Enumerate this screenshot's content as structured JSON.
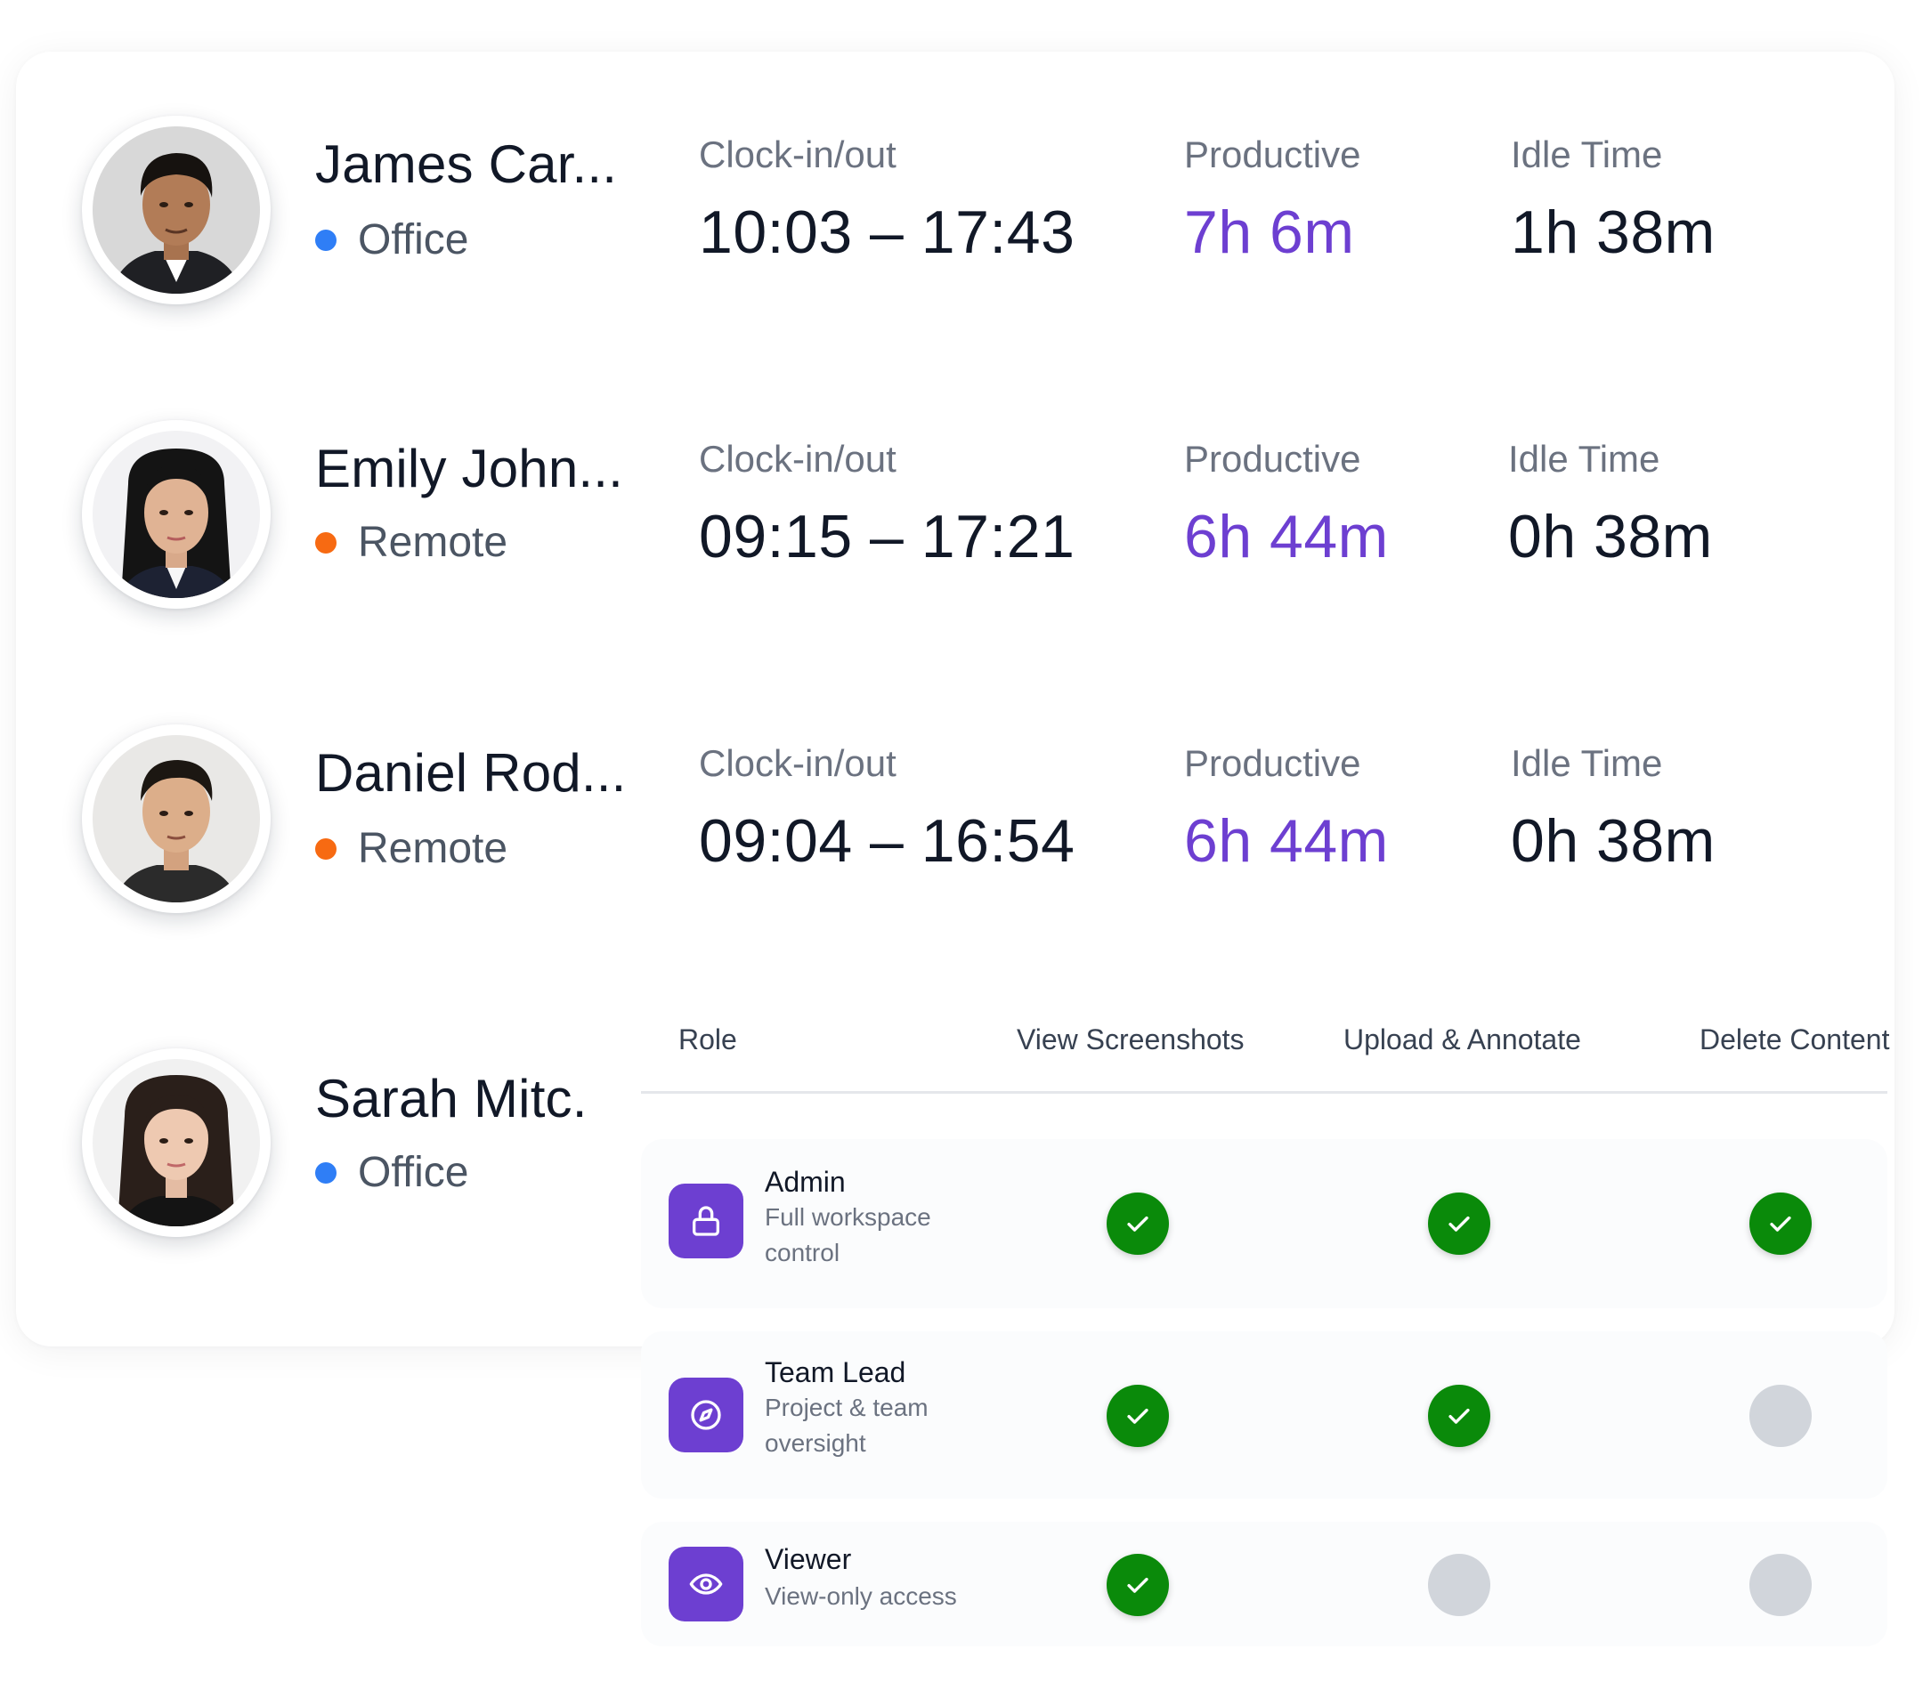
{
  "colors": {
    "office_dot": "#2f7ef6",
    "remote_dot": "#f76a12",
    "productive_text": "#6d3fd1",
    "role_icon_bg": "#6d3fd1",
    "check_on": "#0a8a0a",
    "check_off": "#d1d5db"
  },
  "employees": [
    {
      "name": "James Car...",
      "location": "Office",
      "location_type": "office",
      "clock_label": "Clock-in/out",
      "clock_value": "10:03 – 17:43",
      "productive_label": "Productive",
      "productive_value": "7h 6m",
      "idle_label": "Idle Time",
      "idle_value": "1h 38m",
      "avatar": "person-photo-male-dark-hair"
    },
    {
      "name": "Emily John...",
      "location": "Remote",
      "location_type": "remote",
      "clock_label": "Clock-in/out",
      "clock_value": "09:15 – 17:21",
      "productive_label": "Productive",
      "productive_value": "6h 44m",
      "idle_label": "Idle Time",
      "idle_value": "0h 38m",
      "avatar": "person-photo-female-long-hair"
    },
    {
      "name": "Daniel Rod...",
      "location": "Remote",
      "location_type": "remote",
      "clock_label": "Clock-in/out",
      "clock_value": "09:04 – 16:54",
      "productive_label": "Productive",
      "productive_value": "6h 44m",
      "idle_label": "Idle Time",
      "idle_value": "0h 38m",
      "avatar": "person-photo-male-short-hair"
    },
    {
      "name": "Sarah Mitc.",
      "location": "Office",
      "location_type": "office",
      "avatar": "person-photo-female-long-hair"
    }
  ],
  "permissions": {
    "headers": {
      "role": "Role",
      "view": "View Screenshots",
      "upload": "Upload & Annotate",
      "delete": "Delete Content"
    },
    "rows": [
      {
        "name": "Admin",
        "description": "Full workspace control",
        "icon": "lock-icon",
        "view": true,
        "upload": true,
        "delete": true
      },
      {
        "name": "Team Lead",
        "description": "Project & team oversight",
        "icon": "compass-icon",
        "view": true,
        "upload": true,
        "delete": false
      },
      {
        "name": "Viewer",
        "description": "View-only access",
        "icon": "eye-icon",
        "view": true,
        "upload": false,
        "delete": false
      }
    ]
  }
}
